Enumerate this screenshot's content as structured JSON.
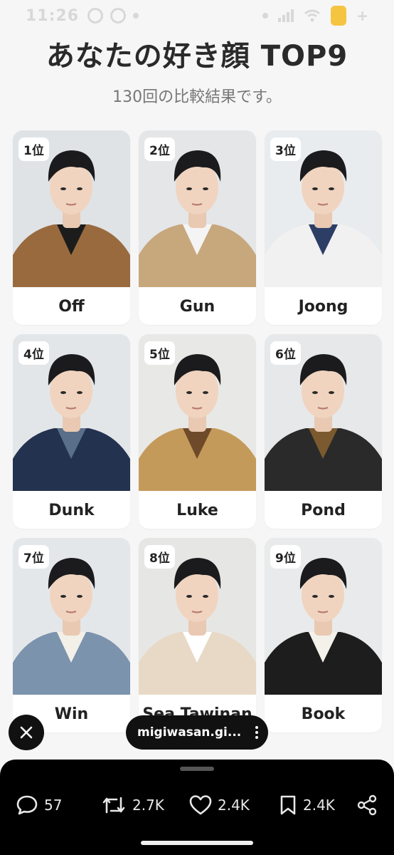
{
  "status_bar": {
    "time": "11:26"
  },
  "title": "あなたの好き顔 TOP9",
  "subtitle": "130回の比較結果です。",
  "cards": [
    {
      "rank": "1位",
      "name": "Off",
      "bg": "#dfe3e6",
      "jacket": "#9a6a3f",
      "collar": "#1c1c1c"
    },
    {
      "rank": "2位",
      "name": "Gun",
      "bg": "#e4e6e8",
      "jacket": "#c7a77c",
      "collar": "#f4f4f4"
    },
    {
      "rank": "3位",
      "name": "Joong",
      "bg": "#e9ecee",
      "jacket": "#f1f1f1",
      "collar": "#2c3e66"
    },
    {
      "rank": "4位",
      "name": "Dunk",
      "bg": "#e3e6e9",
      "jacket": "#23324f",
      "collar": "#5a6f8a"
    },
    {
      "rank": "5位",
      "name": "Luke",
      "bg": "#e8e8e6",
      "jacket": "#c49a5a",
      "collar": "#6e4a2a"
    },
    {
      "rank": "6位",
      "name": "Pond",
      "bg": "#e6e8ea",
      "jacket": "#2a2a2a",
      "collar": "#7a5a2e"
    },
    {
      "rank": "7位",
      "name": "Win",
      "bg": "#e4e7ea",
      "jacket": "#7b93ad",
      "collar": "#f2f0e8"
    },
    {
      "rank": "8位",
      "name": "Sea Tawinan",
      "bg": "#e6e6e4",
      "jacket": "#e8d9c6",
      "collar": "#ffffff"
    },
    {
      "rank": "9位",
      "name": "Book",
      "bg": "#e9eaeb",
      "jacket": "#1d1d1d",
      "collar": "#f4f1ea"
    }
  ],
  "source_pill": {
    "label": "migiwasan.gi..."
  },
  "actions": {
    "replies": "57",
    "reposts": "2.7K",
    "likes": "2.4K",
    "bookmarks": "2.4K"
  }
}
